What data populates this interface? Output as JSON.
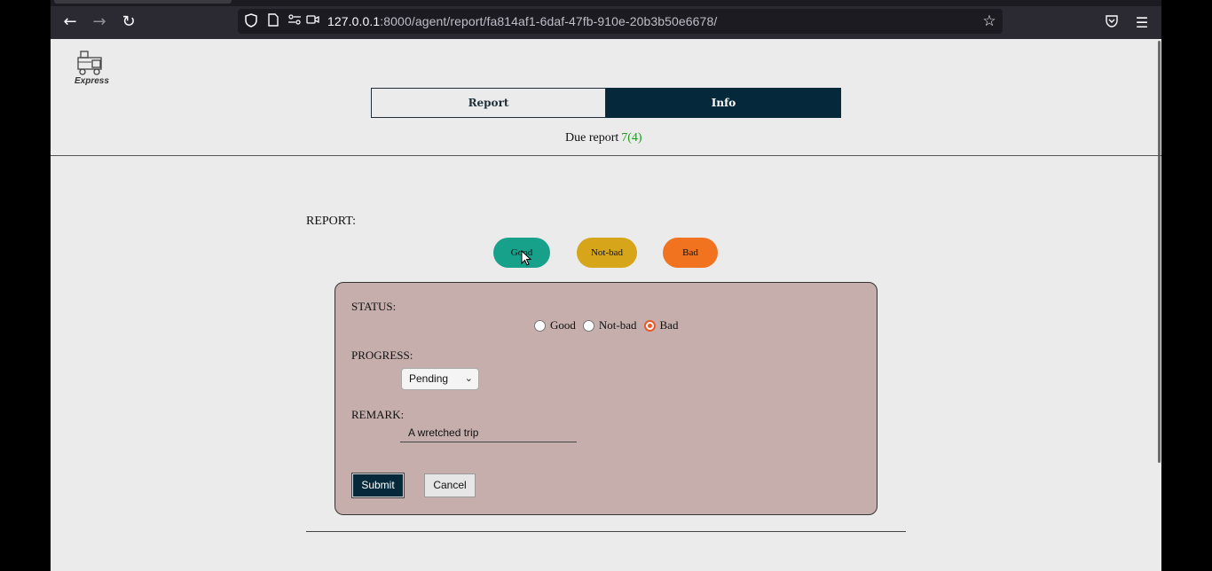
{
  "browser": {
    "url_host": "127.0.0.1",
    "url_rest": ":8000/agent/report/fa814af1-6daf-47fb-910e-20b3b50e6678/"
  },
  "header": {
    "logo_text": "Express",
    "tabs": [
      {
        "label": "Report",
        "active": false
      },
      {
        "label": "Info",
        "active": true
      }
    ],
    "due_label": "Due report",
    "due_count": "7(4)"
  },
  "report": {
    "label": "REPORT:",
    "pills": [
      "Good",
      "Not-bad",
      "Bad"
    ]
  },
  "form": {
    "status_label": "STATUS:",
    "status_options": [
      "Good",
      "Not-bad",
      "Bad"
    ],
    "status_selected": "Bad",
    "progress_label": "PROGRESS:",
    "progress_value": "Pending",
    "remark_label": "REMARK:",
    "remark_value": "A wretched trip",
    "submit_label": "Submit",
    "cancel_label": "Cancel"
  },
  "colors": {
    "navy": "#05293a",
    "good": "#17a08a",
    "notbad": "#d6a51a",
    "bad": "#f1731f",
    "form_bg": "#c5aeab",
    "due_count": "#1a9a1a"
  }
}
